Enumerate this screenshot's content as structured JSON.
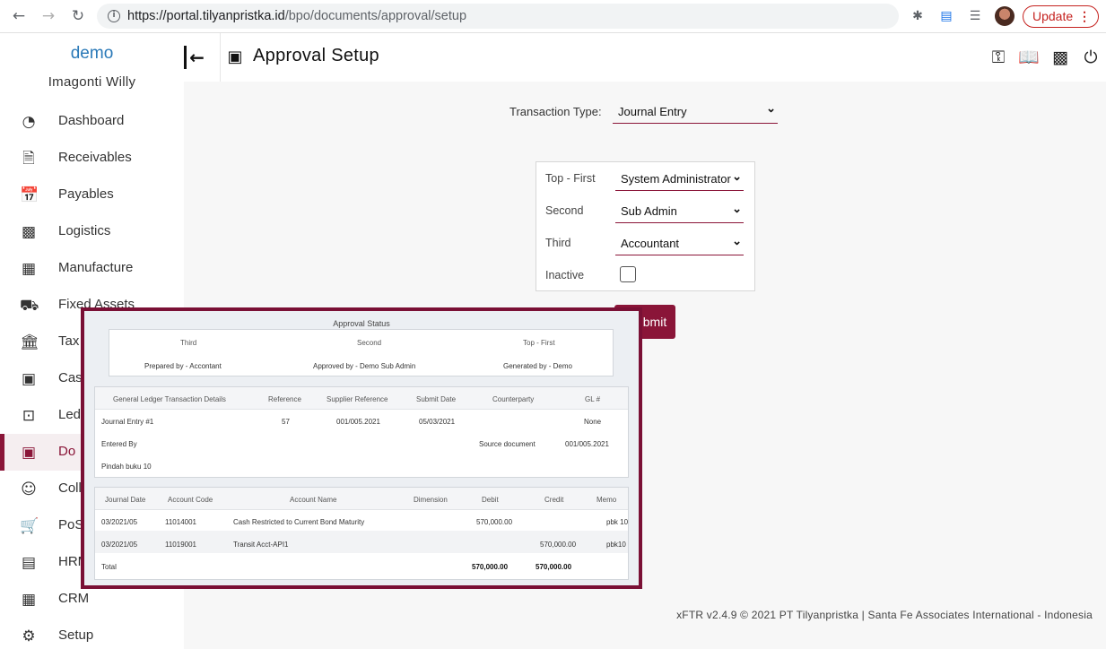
{
  "browser": {
    "url_host": "https://portal.tilyanpristka.id",
    "url_path": "/bpo/documents/approval/setup",
    "update_label": "Update",
    "update_dots": "⋮"
  },
  "sidebar": {
    "brand": "demo",
    "user": "Imagonti Willy",
    "items": [
      {
        "icon": "dashboard-icon",
        "label": "Dashboard"
      },
      {
        "icon": "receivables-icon",
        "label": "Receivables"
      },
      {
        "icon": "payables-icon",
        "label": "Payables"
      },
      {
        "icon": "logistics-icon",
        "label": "Logistics"
      },
      {
        "icon": "manufacture-icon",
        "label": "Manufacture"
      },
      {
        "icon": "fixed-assets-icon",
        "label": "Fixed Assets"
      },
      {
        "icon": "tax-icon",
        "label": "Tax"
      },
      {
        "icon": "cash-icon",
        "label": "Cas"
      },
      {
        "icon": "ledger-icon",
        "label": "Led"
      },
      {
        "icon": "documents-icon",
        "label": "Do"
      },
      {
        "icon": "collections-icon",
        "label": "Coll"
      },
      {
        "icon": "pos-icon",
        "label": "PoS"
      },
      {
        "icon": "hrm-icon",
        "label": "HRM"
      },
      {
        "icon": "crm-icon",
        "label": "CRM"
      },
      {
        "icon": "setup-icon",
        "label": "Setup"
      }
    ],
    "active_index": 9
  },
  "header": {
    "title": "Approval Setup"
  },
  "form": {
    "transaction_type_label": "Transaction Type:",
    "transaction_type_value": "Journal Entry",
    "levels": [
      {
        "label": "Top - First",
        "value": "System Administrator"
      },
      {
        "label": "Second",
        "value": "Sub Admin"
      },
      {
        "label": "Third",
        "value": "Accountant"
      }
    ],
    "inactive_label": "Inactive",
    "submit_label": "Submit",
    "submit_visible": "bmit"
  },
  "footer": {
    "text": "xFTR v2.4.9 © 2021 PT Tilyanpristka | Santa Fe Associates International - Indonesia"
  },
  "preview": {
    "title": "Approval Status",
    "status_headers": [
      "Third",
      "Second",
      "Top - First"
    ],
    "status_values": [
      "Prepared by - Accontant",
      "Approved by - Demo Sub Admin",
      "Generated by - Demo"
    ],
    "gl_headers": [
      "General Ledger Transaction Details",
      "Reference",
      "Supplier Reference",
      "Submit Date",
      "Counterparty",
      "GL #"
    ],
    "gl_row": [
      "Journal Entry #1",
      "57",
      "001/005.2021",
      "05/03/2021",
      "",
      "None"
    ],
    "entered_by_label": "Entered By",
    "source_document_label": "Source document",
    "source_document_value": "001/005.2021",
    "memo_line": "Pindah buku 10",
    "journal_headers": [
      "Journal Date",
      "Account Code",
      "Account Name",
      "Dimension",
      "Debit",
      "Credit",
      "Memo"
    ],
    "journal_rows": [
      [
        "03/2021/05",
        "11014001",
        "Cash Restricted to Current Bond Maturity",
        "",
        "570,000.00",
        "",
        "pbk 10"
      ],
      [
        "03/2021/05",
        "11019001",
        "Transit Acct-API1",
        "",
        "",
        "570,000.00",
        "pbk10"
      ]
    ],
    "total_label": "Total",
    "total_debit": "570,000.00",
    "total_credit": "570,000.00"
  }
}
